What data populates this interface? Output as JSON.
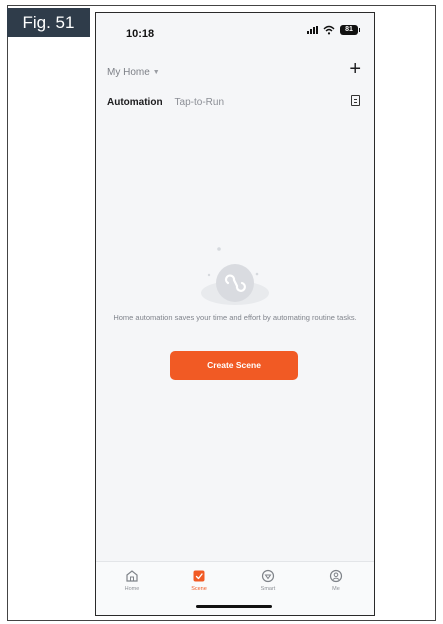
{
  "figure_label": "Fig. 51",
  "status_bar": {
    "time": "10:18",
    "battery": "81"
  },
  "header": {
    "home_selector": "My Home",
    "add_icon": "plus-icon"
  },
  "tabs": [
    {
      "label": "Automation",
      "active": true
    },
    {
      "label": "Tap-to-Run",
      "active": false
    }
  ],
  "empty_state": {
    "message": "Home automation saves your time and effort by automating routine tasks.",
    "button_label": "Create Scene"
  },
  "bottom_nav": [
    {
      "label": "Home",
      "icon": "home-icon",
      "active": false
    },
    {
      "label": "Scene",
      "icon": "scene-icon",
      "active": true
    },
    {
      "label": "Smart",
      "icon": "smart-icon",
      "active": false
    },
    {
      "label": "Me",
      "icon": "me-icon",
      "active": false
    }
  ],
  "colors": {
    "accent": "#f15a24",
    "background": "#f5f6f8",
    "figure_label_background": "#2f3c4a"
  }
}
